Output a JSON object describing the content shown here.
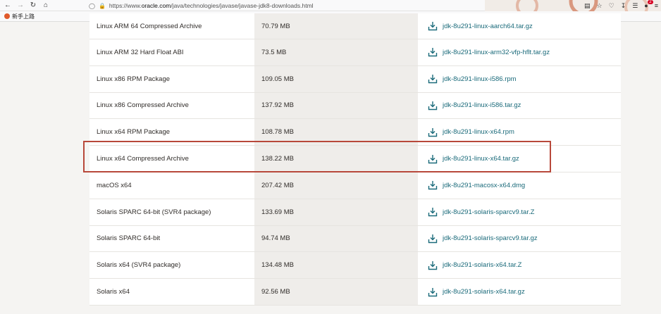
{
  "browser": {
    "url_prefix": "https://www.",
    "url_host": "oracle.com",
    "url_path": "/java/technologies/javase/javase-jdk8-downloads.html",
    "bookmark_label": "新手上路",
    "notification_count": "2",
    "brand_color": "#c74634"
  },
  "downloads": [
    {
      "product": "Linux ARM 64 Compressed Archive",
      "size": "70.79 MB",
      "file": "jdk-8u291-linux-aarch64.tar.gz"
    },
    {
      "product": "Linux ARM 32 Hard Float ABI",
      "size": "73.5 MB",
      "file": "jdk-8u291-linux-arm32-vfp-hflt.tar.gz"
    },
    {
      "product": "Linux x86 RPM Package",
      "size": "109.05 MB",
      "file": "jdk-8u291-linux-i586.rpm"
    },
    {
      "product": "Linux x86 Compressed Archive",
      "size": "137.92 MB",
      "file": "jdk-8u291-linux-i586.tar.gz"
    },
    {
      "product": "Linux x64 RPM Package",
      "size": "108.78 MB",
      "file": "jdk-8u291-linux-x64.rpm"
    },
    {
      "product": "Linux x64 Compressed Archive",
      "size": "138.22 MB",
      "file": "jdk-8u291-linux-x64.tar.gz"
    },
    {
      "product": "macOS x64",
      "size": "207.42 MB",
      "file": "jdk-8u291-macosx-x64.dmg"
    },
    {
      "product": "Solaris SPARC 64-bit (SVR4 package)",
      "size": "133.69 MB",
      "file": "jdk-8u291-solaris-sparcv9.tar.Z"
    },
    {
      "product": "Solaris SPARC 64-bit",
      "size": "94.74 MB",
      "file": "jdk-8u291-solaris-sparcv9.tar.gz"
    },
    {
      "product": "Solaris x64 (SVR4 package)",
      "size": "134.48 MB",
      "file": "jdk-8u291-solaris-x64.tar.Z"
    },
    {
      "product": "Solaris x64",
      "size": "92.56 MB",
      "file": "jdk-8u291-solaris-x64.tar.gz"
    }
  ],
  "highlighted_row_index": 5,
  "link_color": "#1a6a7a",
  "highlight_color": "#b8483a"
}
